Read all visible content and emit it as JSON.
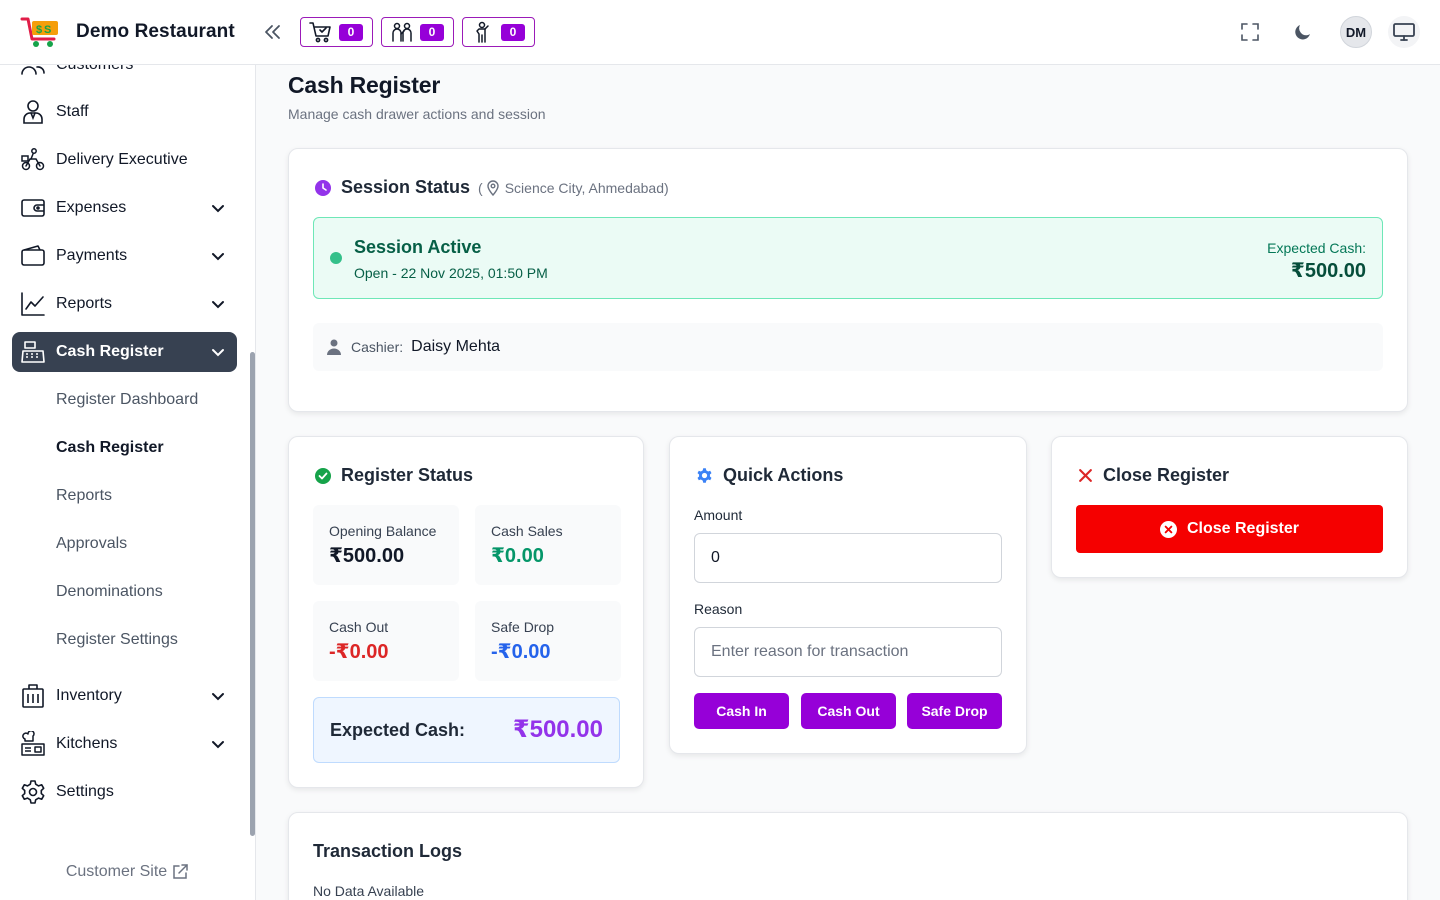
{
  "header": {
    "brand_name": "Demo Restaurant",
    "badges": [
      {
        "name": "cart",
        "count": "0"
      },
      {
        "name": "waiter-request",
        "count": "0"
      },
      {
        "name": "customer-call",
        "count": "0"
      }
    ],
    "avatar_initials": "DM",
    "icons": [
      "fullscreen-icon",
      "moon-icon",
      "monitor-icon"
    ]
  },
  "sidebar": {
    "items": [
      {
        "label": "Customers",
        "icon": "customers-icon"
      },
      {
        "label": "Staff",
        "icon": "staff-icon"
      },
      {
        "label": "Delivery Executive",
        "icon": "delivery-icon"
      },
      {
        "label": "Expenses",
        "icon": "wallet-icon"
      },
      {
        "label": "Payments",
        "icon": "payments-icon"
      },
      {
        "label": "Reports",
        "icon": "chart-icon"
      },
      {
        "label": "Cash Register",
        "icon": "register-icon"
      },
      {
        "label": "Inventory",
        "icon": "inventory-icon"
      },
      {
        "label": "Kitchens",
        "icon": "kitchen-icon"
      },
      {
        "label": "Settings",
        "icon": "gear-icon"
      }
    ],
    "subitems": [
      "Register Dashboard",
      "Cash Register",
      "Reports",
      "Approvals",
      "Denominations",
      "Register Settings"
    ],
    "footer_link": "Customer Site"
  },
  "page": {
    "title": "Cash Register",
    "subtitle": "Manage cash drawer actions and session"
  },
  "session": {
    "title": "Session Status",
    "location": "(📍 Science City, Ahmedabad)",
    "location_text": "Science City, Ahmedabad",
    "active_title": "Session Active",
    "opened": "Open - 22 Nov 2025, 01:50 PM",
    "expected_label": "Expected Cash:",
    "expected_value": "₹500.00",
    "cashier_label": "Cashier:",
    "cashier_name": "Daisy Mehta"
  },
  "register_status": {
    "title": "Register Status",
    "opening_label": "Opening Balance",
    "opening_value": "₹500.00",
    "sales_label": "Cash Sales",
    "sales_value": "₹0.00",
    "cashout_label": "Cash Out",
    "cashout_value": "-₹0.00",
    "safedrop_label": "Safe Drop",
    "safedrop_value": "-₹0.00",
    "expected_label": "Expected Cash:",
    "expected_value": "₹500.00"
  },
  "quick_actions": {
    "title": "Quick Actions",
    "amount_label": "Amount",
    "amount_value": "0",
    "reason_label": "Reason",
    "reason_placeholder": "Enter reason for transaction",
    "cash_in": "Cash In",
    "cash_out": "Cash Out",
    "safe_drop": "Safe Drop"
  },
  "close_register": {
    "title": "Close Register",
    "button": "Close Register"
  },
  "transaction_logs": {
    "title": "Transaction Logs",
    "empty": "No Data Available"
  },
  "colors": {
    "accent": "#9600d8",
    "danger": "#f50000",
    "success": "#34c08a",
    "sidebar_active": "#374151"
  }
}
